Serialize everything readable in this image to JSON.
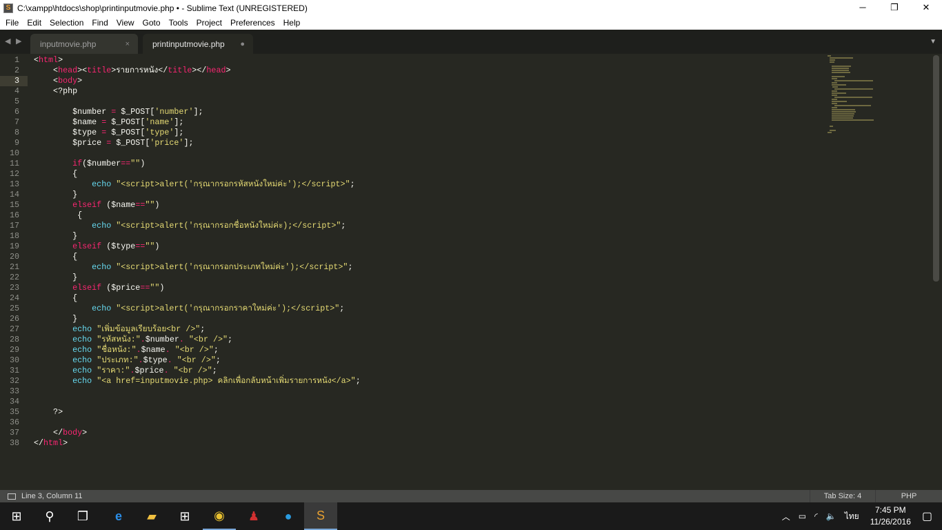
{
  "window": {
    "title": "C:\\xampp\\htdocs\\shop\\printinputmovie.php • - Sublime Text (UNREGISTERED)",
    "minimize": "─",
    "restore": "❐",
    "close": "✕"
  },
  "menu": [
    "File",
    "Edit",
    "Selection",
    "Find",
    "View",
    "Goto",
    "Tools",
    "Project",
    "Preferences",
    "Help"
  ],
  "tabs": [
    {
      "label": "inputmovie.php",
      "close": "×"
    },
    {
      "label": "printinputmovie.php",
      "dirty": "●"
    }
  ],
  "editor": {
    "current_line": 3,
    "lines": [
      [
        [
          "p",
          "<"
        ],
        [
          "k",
          "html"
        ],
        [
          "p",
          ">"
        ]
      ],
      [
        [
          "p",
          "    <"
        ],
        [
          "k",
          "head"
        ],
        [
          "p",
          "><"
        ],
        [
          "k",
          "title"
        ],
        [
          "p",
          ">รายการหนัง</"
        ],
        [
          "k",
          "title"
        ],
        [
          "p",
          "></"
        ],
        [
          "k",
          "head"
        ],
        [
          "p",
          ">"
        ]
      ],
      [
        [
          "p",
          "    <"
        ],
        [
          "k",
          "body"
        ],
        [
          "p",
          ">"
        ]
      ],
      [
        [
          "p",
          "    <?php"
        ]
      ],
      [],
      [
        [
          "p",
          "        $number "
        ],
        [
          "o",
          "="
        ],
        [
          "p",
          " $_POST["
        ],
        [
          "s",
          "'number'"
        ],
        [
          "p",
          "];"
        ]
      ],
      [
        [
          "p",
          "        $name "
        ],
        [
          "o",
          "="
        ],
        [
          "p",
          " $_POST["
        ],
        [
          "s",
          "'name'"
        ],
        [
          "p",
          "];"
        ]
      ],
      [
        [
          "p",
          "        $type "
        ],
        [
          "o",
          "="
        ],
        [
          "p",
          " $_POST["
        ],
        [
          "s",
          "'type'"
        ],
        [
          "p",
          "];"
        ]
      ],
      [
        [
          "p",
          "        $price "
        ],
        [
          "o",
          "="
        ],
        [
          "p",
          " $_POST["
        ],
        [
          "s",
          "'price'"
        ],
        [
          "p",
          "];"
        ]
      ],
      [],
      [
        [
          "p",
          "        "
        ],
        [
          "k",
          "if"
        ],
        [
          "p",
          "($number"
        ],
        [
          "o",
          "=="
        ],
        [
          "s",
          "\"\""
        ],
        [
          "p",
          ")"
        ]
      ],
      [
        [
          "p",
          "        {"
        ]
      ],
      [
        [
          "p",
          "            "
        ],
        [
          "f",
          "echo"
        ],
        [
          "p",
          " "
        ],
        [
          "s",
          "\"<script>alert('กรุณากรอกรหัสหนังใหม่ค่ะ');</script>\""
        ],
        [
          "p",
          ";"
        ]
      ],
      [
        [
          "p",
          "        }"
        ]
      ],
      [
        [
          "p",
          "        "
        ],
        [
          "k",
          "elseif"
        ],
        [
          "p",
          " ($name"
        ],
        [
          "o",
          "=="
        ],
        [
          "s",
          "\"\""
        ],
        [
          "p",
          ")"
        ]
      ],
      [
        [
          "p",
          "         {"
        ]
      ],
      [
        [
          "p",
          "            "
        ],
        [
          "f",
          "echo"
        ],
        [
          "p",
          " "
        ],
        [
          "s",
          "\"<script>alert('กรุณากรอกชื่อหนังใหม่ค่ะ);</script>\""
        ],
        [
          "p",
          ";"
        ]
      ],
      [
        [
          "p",
          "        }"
        ]
      ],
      [
        [
          "p",
          "        "
        ],
        [
          "k",
          "elseif"
        ],
        [
          "p",
          " ($type"
        ],
        [
          "o",
          "=="
        ],
        [
          "s",
          "\"\""
        ],
        [
          "p",
          ")"
        ]
      ],
      [
        [
          "p",
          "        {"
        ]
      ],
      [
        [
          "p",
          "            "
        ],
        [
          "f",
          "echo"
        ],
        [
          "p",
          " "
        ],
        [
          "s",
          "\"<script>alert('กรุณากรอกประเภทใหม่ค่ะ');</script>\""
        ],
        [
          "p",
          ";"
        ]
      ],
      [
        [
          "p",
          "        }"
        ]
      ],
      [
        [
          "p",
          "        "
        ],
        [
          "k",
          "elseif"
        ],
        [
          "p",
          " ($price"
        ],
        [
          "o",
          "=="
        ],
        [
          "s",
          "\"\""
        ],
        [
          "p",
          ")"
        ]
      ],
      [
        [
          "p",
          "        {"
        ]
      ],
      [
        [
          "p",
          "            "
        ],
        [
          "f",
          "echo"
        ],
        [
          "p",
          " "
        ],
        [
          "s",
          "\"<script>alert('กรุณากรอกราคาใหม่ค่ะ');</script>\""
        ],
        [
          "p",
          ";"
        ]
      ],
      [
        [
          "p",
          "        }"
        ]
      ],
      [
        [
          "p",
          "        "
        ],
        [
          "f",
          "echo"
        ],
        [
          "p",
          " "
        ],
        [
          "s",
          "\"เพิ่มข้อมูลเรียบร้อย<br />\""
        ],
        [
          "p",
          ";"
        ]
      ],
      [
        [
          "p",
          "        "
        ],
        [
          "f",
          "echo"
        ],
        [
          "p",
          " "
        ],
        [
          "s",
          "\"รหัสหนัง:\""
        ],
        [
          "o",
          "."
        ],
        [
          "p",
          "$number"
        ],
        [
          "o",
          "."
        ],
        [
          "p",
          " "
        ],
        [
          "s",
          "\"<br />\""
        ],
        [
          "p",
          ";"
        ]
      ],
      [
        [
          "p",
          "        "
        ],
        [
          "f",
          "echo"
        ],
        [
          "p",
          " "
        ],
        [
          "s",
          "\"ชื่อหนัง:\""
        ],
        [
          "o",
          "."
        ],
        [
          "p",
          "$name"
        ],
        [
          "o",
          "."
        ],
        [
          "p",
          " "
        ],
        [
          "s",
          "\"<br />\""
        ],
        [
          "p",
          ";"
        ]
      ],
      [
        [
          "p",
          "        "
        ],
        [
          "f",
          "echo"
        ],
        [
          "p",
          " "
        ],
        [
          "s",
          "\"ประเภท:\""
        ],
        [
          "o",
          "."
        ],
        [
          "p",
          "$type"
        ],
        [
          "o",
          "."
        ],
        [
          "p",
          " "
        ],
        [
          "s",
          "\"<br />\""
        ],
        [
          "p",
          ";"
        ]
      ],
      [
        [
          "p",
          "        "
        ],
        [
          "f",
          "echo"
        ],
        [
          "p",
          " "
        ],
        [
          "s",
          "\"ราคา:\""
        ],
        [
          "o",
          "."
        ],
        [
          "p",
          "$price"
        ],
        [
          "o",
          "."
        ],
        [
          "p",
          " "
        ],
        [
          "s",
          "\"<br />\""
        ],
        [
          "p",
          ";"
        ]
      ],
      [
        [
          "p",
          "        "
        ],
        [
          "f",
          "echo"
        ],
        [
          "p",
          " "
        ],
        [
          "s",
          "\"<a href=inputmovie.php> คลิกเพื่อกลับหน้าเพิ่มรายการหนัง</a>\""
        ],
        [
          "p",
          ";"
        ]
      ],
      [],
      [],
      [
        [
          "p",
          "    ?>"
        ]
      ],
      [],
      [
        [
          "p",
          "    </"
        ],
        [
          "k",
          "body"
        ],
        [
          "p",
          ">"
        ]
      ],
      [
        [
          "p",
          "</"
        ],
        [
          "k",
          "html"
        ],
        [
          "p",
          ">"
        ]
      ]
    ]
  },
  "status": {
    "position": "Line 3, Column 11",
    "tab_size": "Tab Size: 4",
    "syntax": "PHP"
  },
  "taskbar": {
    "language": "ไทย",
    "time": "7:45 PM",
    "date": "11/26/2016"
  }
}
